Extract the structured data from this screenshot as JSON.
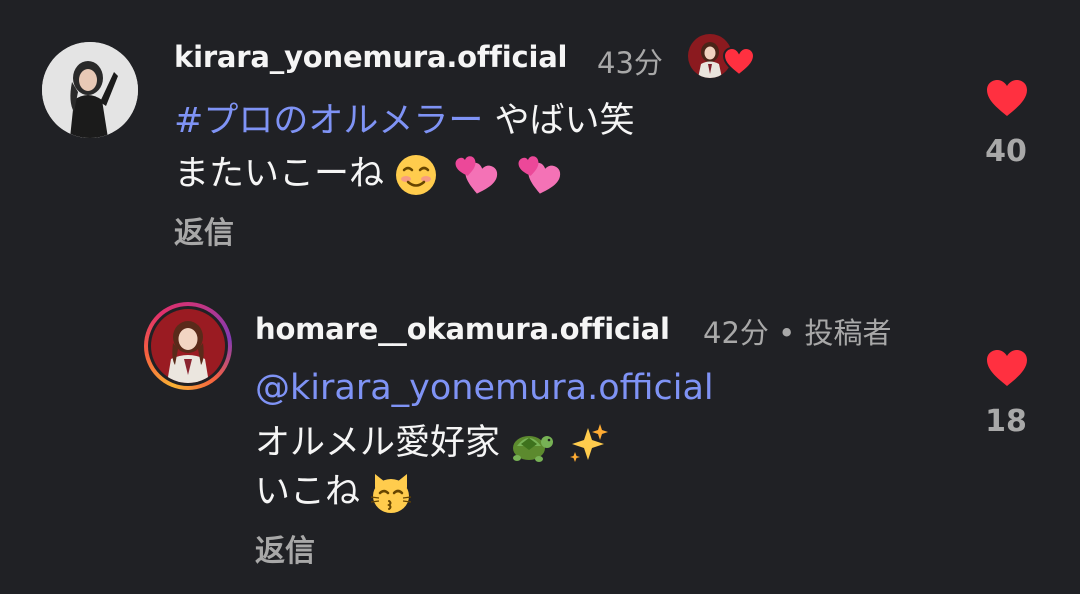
{
  "comments": [
    {
      "username": "kirara_yonemura.official",
      "time": "43分",
      "hashtag": "#プロのオルメラー",
      "line1_rest": " やばい笑",
      "line2": "またいこーね",
      "line2_emojis": [
        "smiling-face-icon",
        "two-hearts-icon",
        "two-hearts-icon"
      ],
      "reply_label": "返信",
      "likes": "40",
      "liked": true
    },
    {
      "username": "homare__okamura.official",
      "time": "42分",
      "separator": " • ",
      "author_badge": "投稿者",
      "mention": "@kirara_yonemura.official",
      "line2": "オルメル愛好家",
      "line2_emojis": [
        "turtle-icon",
        "sparkles-icon"
      ],
      "line3": "いこね",
      "line3_emojis": [
        "kissing-cat-icon"
      ],
      "reply_label": "返信",
      "likes": "18",
      "liked": true
    }
  ],
  "colors": {
    "background": "#202125",
    "text": "#f5f5f5",
    "muted": "#a8a8a8",
    "link": "#7f93f5",
    "like": "#ff3040"
  }
}
